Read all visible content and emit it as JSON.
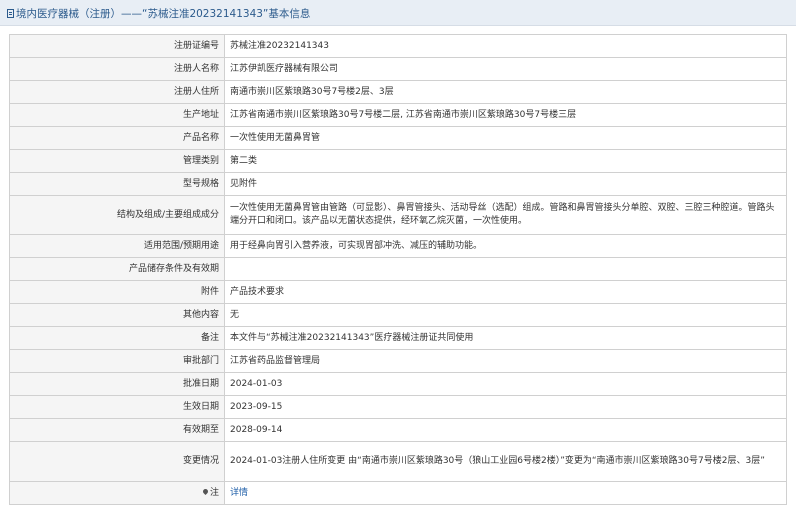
{
  "header": {
    "title": "境内医疗器械（注册）——“苏械注准20232141343”基本信息"
  },
  "rows": [
    {
      "label": "注册证编号",
      "value": "苏械注准20232141343"
    },
    {
      "label": "注册人名称",
      "value": "江苏伊凯医疗器械有限公司"
    },
    {
      "label": "注册人住所",
      "value": "南通市崇川区紫琅路30号7号楼2层、3层"
    },
    {
      "label": "生产地址",
      "value": "江苏省南通市崇川区紫琅路30号7号楼二层, 江苏省南通市崇川区紫琅路30号7号楼三层"
    },
    {
      "label": "产品名称",
      "value": "一次性使用无菌鼻胃管"
    },
    {
      "label": "管理类别",
      "value": "第二类"
    },
    {
      "label": "型号规格",
      "value": "见附件"
    },
    {
      "label": "结构及组成/主要组成成分",
      "value": "一次性使用无菌鼻胃管由管路（可显影）、鼻胃管接头、活动导丝（选配）组成。管路和鼻胃管接头分单腔、双腔、三腔三种腔道。管路头端分开口和闭口。该产品以无菌状态提供，经环氧乙烷灭菌，一次性使用。"
    },
    {
      "label": "适用范围/预期用途",
      "value": "用于经鼻向胃引入营养液，可实现胃部冲洗、减压的辅助功能。"
    },
    {
      "label": "产品储存条件及有效期",
      "value": ""
    },
    {
      "label": "附件",
      "value": "产品技术要求"
    },
    {
      "label": "其他内容",
      "value": "无"
    },
    {
      "label": "备注",
      "value": "本文件与“苏械注准20232141343”医疗器械注册证共同使用"
    },
    {
      "label": "审批部门",
      "value": "江苏省药品监督管理局"
    },
    {
      "label": "批准日期",
      "value": "2024-01-03"
    },
    {
      "label": "生效日期",
      "value": "2023-09-15"
    },
    {
      "label": "有效期至",
      "value": "2028-09-14"
    },
    {
      "label": "变更情况",
      "value": "2024-01-03注册人住所变更 由“南通市崇川区紫琅路30号（狼山工业园6号楼2楼）”变更为“南通市崇川区紫琅路30号7号楼2层、3层”"
    }
  ],
  "note": {
    "label": "注",
    "value": "详情",
    "icon": "location-pin-icon"
  }
}
